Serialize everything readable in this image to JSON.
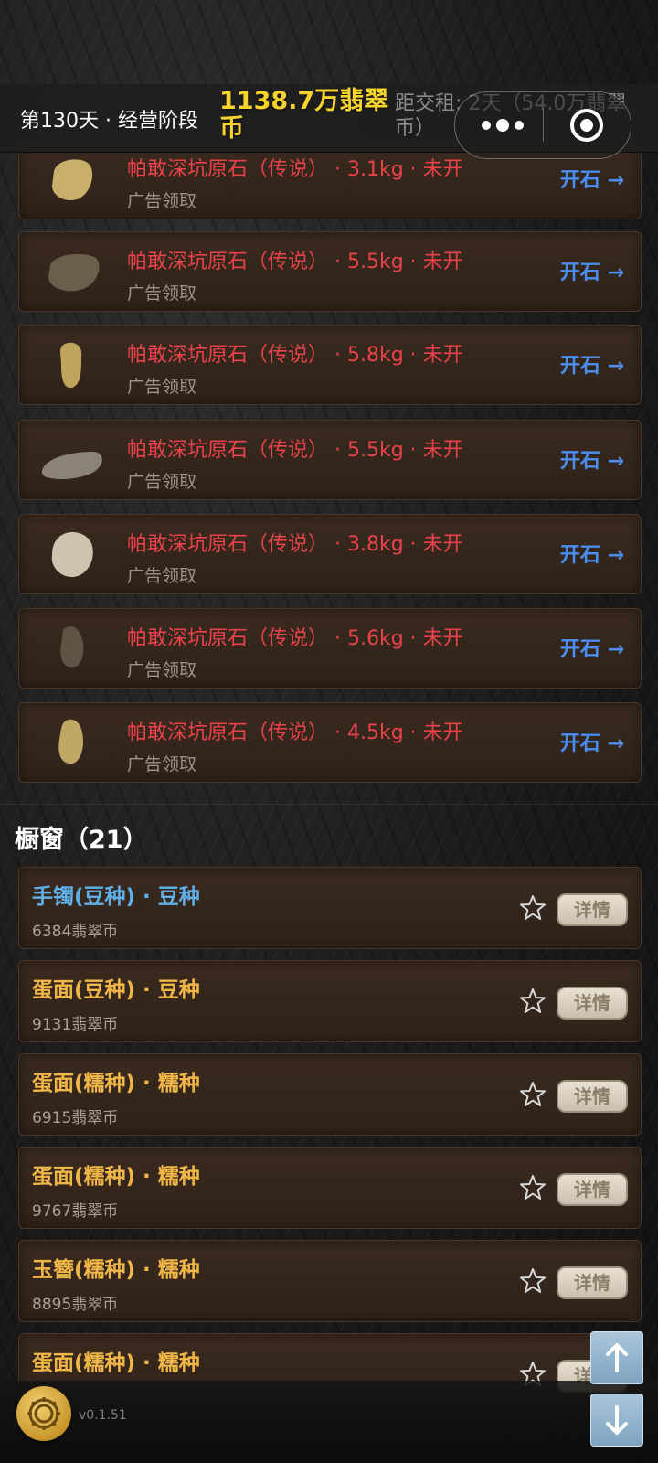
{
  "header": {
    "day_phase": "第130天 · 经营阶段",
    "coins": "1138.7万翡翠币",
    "rent_info": "距交租: 2天（54.0万翡翠币）"
  },
  "capsule": {
    "more_icon": "more-dots-icon",
    "close_icon": "target-close-icon"
  },
  "stones": [
    {
      "title": "帕敢深坑原石（传说） · 3.1kg · 未开",
      "sub": "广告领取",
      "action": "开石 →",
      "color": "#c8b06a"
    },
    {
      "title": "帕敢深坑原石（传说） · 5.5kg · 未开",
      "sub": "广告领取",
      "action": "开石 →",
      "color": "#6b5f4c"
    },
    {
      "title": "帕敢深坑原石（传说） · 5.8kg · 未开",
      "sub": "广告领取",
      "action": "开石 →",
      "color": "#bfa55c"
    },
    {
      "title": "帕敢深坑原石（传说） · 5.5kg · 未开",
      "sub": "广告领取",
      "action": "开石 →",
      "color": "#8a8377"
    },
    {
      "title": "帕敢深坑原石（传说） · 3.8kg · 未开",
      "sub": "广告领取",
      "action": "开石 →",
      "color": "#cdc4b0"
    },
    {
      "title": "帕敢深坑原石（传说） · 5.6kg · 未开",
      "sub": "广告领取",
      "action": "开石 →",
      "color": "#5e5446"
    },
    {
      "title": "帕敢深坑原石（传说） · 4.5kg · 未开",
      "sub": "广告领取",
      "action": "开石 →",
      "color": "#bfa766"
    }
  ],
  "showcase": {
    "title": "橱窗（21）",
    "items": [
      {
        "name": "手镯(豆种) · 豆种",
        "price": "6384翡翠币",
        "name_color": "#5fb0e8",
        "detail": "详情"
      },
      {
        "name": "蛋面(豆种) · 豆种",
        "price": "9131翡翠币",
        "name_color": "#f0b648",
        "detail": "详情"
      },
      {
        "name": "蛋面(糯种) · 糯种",
        "price": "6915翡翠币",
        "name_color": "#f0b648",
        "detail": "详情"
      },
      {
        "name": "蛋面(糯种) · 糯种",
        "price": "9767翡翠币",
        "name_color": "#f0b648",
        "detail": "详情"
      },
      {
        "name": "玉簪(糯种) · 糯种",
        "price": "8895翡翠币",
        "name_color": "#f0b648",
        "detail": "详情"
      },
      {
        "name": "蛋面(糯种) · 糯种",
        "price": "",
        "name_color": "#f0b648",
        "detail": "详情"
      }
    ]
  },
  "footer": {
    "version": "v0.1.51",
    "settings_icon": "gear-icon",
    "scroll_up_icon": "arrow-up-icon",
    "scroll_down_icon": "arrow-down-icon"
  }
}
